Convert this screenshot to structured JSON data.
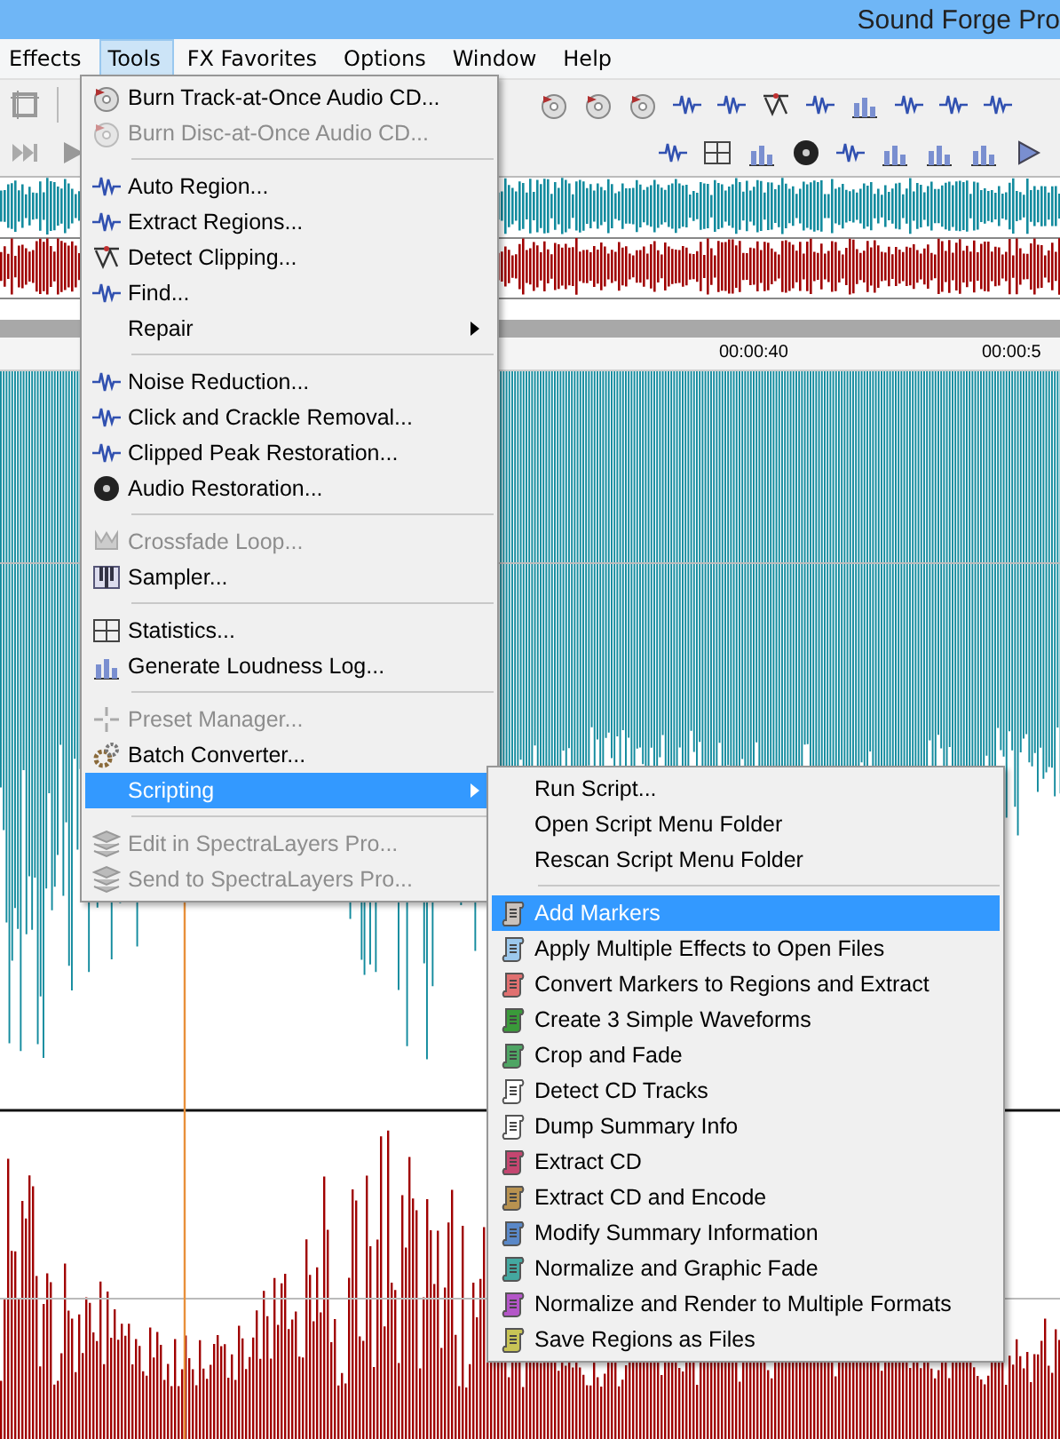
{
  "window": {
    "title": "Sound Forge Pro"
  },
  "menu_bar": [
    {
      "label": "Effects",
      "selected": false
    },
    {
      "label": "Tools",
      "selected": true
    },
    {
      "label": "FX Favorites",
      "selected": false
    },
    {
      "label": "Options",
      "selected": false
    },
    {
      "label": "Window",
      "selected": false
    },
    {
      "label": "Help",
      "selected": false
    }
  ],
  "ruler": {
    "labels": [
      "00:00:40",
      "00:00:5"
    ]
  },
  "tools_menu": {
    "groups": [
      {
        "items": [
          {
            "label": "Burn Track-at-Once Audio CD...",
            "disabled": false,
            "has_submenu": false,
            "selected": false
          },
          {
            "label": "Burn Disc-at-Once Audio CD...",
            "disabled": true,
            "has_submenu": false,
            "selected": false
          }
        ]
      },
      {
        "items": [
          {
            "label": "Auto Region...",
            "disabled": false,
            "has_submenu": false,
            "selected": false
          },
          {
            "label": "Extract Regions...",
            "disabled": false,
            "has_submenu": false,
            "selected": false
          },
          {
            "label": "Detect Clipping...",
            "disabled": false,
            "has_submenu": false,
            "selected": false
          },
          {
            "label": "Find...",
            "disabled": false,
            "has_submenu": false,
            "selected": false
          },
          {
            "label": "Repair",
            "disabled": false,
            "has_submenu": true,
            "selected": false
          }
        ]
      },
      {
        "items": [
          {
            "label": "Noise Reduction...",
            "disabled": false,
            "has_submenu": false,
            "selected": false
          },
          {
            "label": "Click and Crackle Removal...",
            "disabled": false,
            "has_submenu": false,
            "selected": false
          },
          {
            "label": "Clipped Peak Restoration...",
            "disabled": false,
            "has_submenu": false,
            "selected": false
          },
          {
            "label": "Audio Restoration...",
            "disabled": false,
            "has_submenu": false,
            "selected": false
          }
        ]
      },
      {
        "items": [
          {
            "label": "Crossfade Loop...",
            "disabled": true,
            "has_submenu": false,
            "selected": false
          },
          {
            "label": "Sampler...",
            "disabled": false,
            "has_submenu": false,
            "selected": false
          }
        ]
      },
      {
        "items": [
          {
            "label": "Statistics...",
            "disabled": false,
            "has_submenu": false,
            "selected": false
          },
          {
            "label": "Generate Loudness Log...",
            "disabled": false,
            "has_submenu": false,
            "selected": false
          }
        ]
      },
      {
        "items": [
          {
            "label": "Preset Manager...",
            "disabled": true,
            "has_submenu": false,
            "selected": false
          },
          {
            "label": "Batch Converter...",
            "disabled": false,
            "has_submenu": false,
            "selected": false
          },
          {
            "label": "Scripting",
            "disabled": false,
            "has_submenu": true,
            "selected": true
          }
        ]
      },
      {
        "items": [
          {
            "label": "Edit in SpectraLayers Pro...",
            "disabled": true,
            "has_submenu": false,
            "selected": false
          },
          {
            "label": "Send to SpectraLayers Pro...",
            "disabled": true,
            "has_submenu": false,
            "selected": false
          }
        ]
      }
    ]
  },
  "scripting_menu": {
    "commands": [
      {
        "label": "Run Script..."
      },
      {
        "label": "Open Script Menu Folder"
      },
      {
        "label": "Rescan Script Menu Folder"
      }
    ],
    "scripts": [
      {
        "label": "Add Markers",
        "color": "#c9c2bc",
        "selected": true
      },
      {
        "label": "Apply Multiple Effects to Open Files",
        "color": "#9cc8ec",
        "selected": false
      },
      {
        "label": "Convert Markers to Regions and Extract",
        "color": "#e07070",
        "selected": false
      },
      {
        "label": "Create 3 Simple Waveforms",
        "color": "#3a9a3a",
        "selected": false
      },
      {
        "label": "Crop and Fade",
        "color": "#4ea564",
        "selected": false
      },
      {
        "label": "Detect CD Tracks",
        "color": "#ffffff",
        "selected": false
      },
      {
        "label": "Dump Summary Info",
        "color": "#fdfdfd",
        "selected": false
      },
      {
        "label": "Extract CD",
        "color": "#c44670",
        "selected": false
      },
      {
        "label": "Extract CD and Encode",
        "color": "#b89250",
        "selected": false
      },
      {
        "label": "Modify Summary Information",
        "color": "#5a88c8",
        "selected": false
      },
      {
        "label": "Normalize and Graphic Fade",
        "color": "#44a8a0",
        "selected": false
      },
      {
        "label": "Normalize and Render to Multiple Formats",
        "color": "#b456c8",
        "selected": false
      },
      {
        "label": "Save Regions as Files",
        "color": "#c8c456",
        "selected": false
      }
    ]
  }
}
